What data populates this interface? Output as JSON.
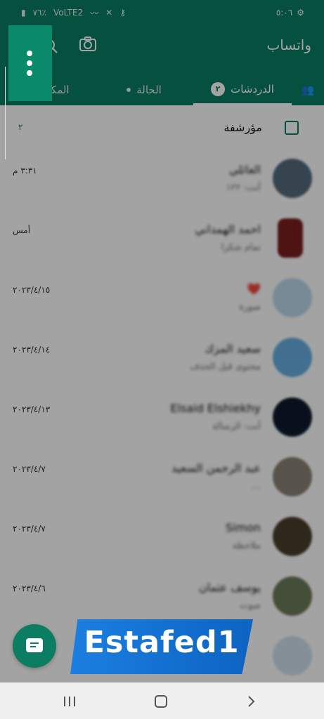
{
  "status": {
    "time": "٥:٠٦",
    "battery": "٧٦٪",
    "network": "VoLTE2"
  },
  "header": {
    "title": "واتساب"
  },
  "tabs": [
    {
      "label": "الدردشات",
      "badge": "٢"
    },
    {
      "label": "الحالة"
    },
    {
      "label": "المكالمات"
    }
  ],
  "archived": {
    "label": "مؤرشفة",
    "count": "٢"
  },
  "chats": [
    {
      "name": "العائلي",
      "preview": "أنت: ١٢٢",
      "time": "٣:٣١ م"
    },
    {
      "name": "احمد الهمداني",
      "preview": "تمام شكرا",
      "time": "أمس"
    },
    {
      "name": "❤️",
      "preview": "صورة",
      "time": "٢٠٢٣/٤/١٥"
    },
    {
      "name": "سعيد المزك",
      "preview": "محتوى قبل الحذف",
      "time": "٢٠٢٣/٤/١٤"
    },
    {
      "name": "Elsaid Elshiekhy",
      "preview": "أنت: الرسالة",
      "time": "٢٠٢٣/٤/١٣"
    },
    {
      "name": "عبد الرحمن السعيد",
      "preview": "...",
      "time": "٢٠٢٣/٤/٧"
    },
    {
      "name": "Simon",
      "preview": "ملاحظة",
      "time": "٢٠٢٣/٤/٧"
    },
    {
      "name": "يوسف عثمان",
      "preview": "صوت",
      "time": "٢٠٢٣/٤/٦"
    }
  ],
  "watermark": {
    "text": "Estafed1"
  },
  "colors": {
    "accent": "#0a7d63",
    "fab": "#0a7d63"
  }
}
